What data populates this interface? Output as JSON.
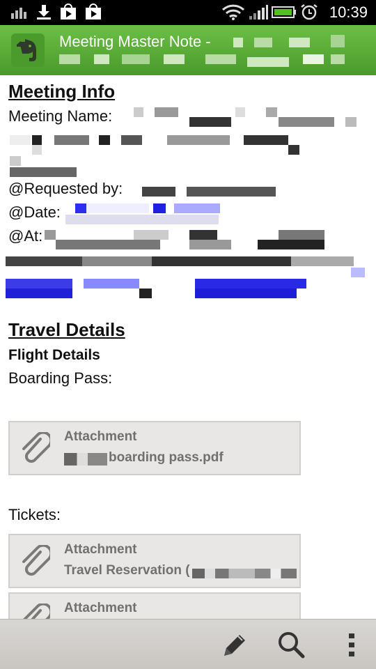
{
  "status_bar": {
    "time": "10:39",
    "icons": [
      "signal-bars-icon",
      "download-icon",
      "play-store-icon",
      "play-store-icon",
      "wifi-icon",
      "cell-signal-icon",
      "battery-icon",
      "alarm-icon"
    ]
  },
  "app_bar": {
    "title": "Meeting Master Note -",
    "icon": "evernote-elephant-icon",
    "color": "#5aa935"
  },
  "note": {
    "meeting_info": {
      "heading": "Meeting Info",
      "meeting_name_label": "Meeting Name:",
      "requested_by_label": "@Requested by:",
      "date_label": "@Date:",
      "at_label": "@At:"
    },
    "travel_details": {
      "heading": "Travel Details",
      "flight_details": "Flight Details",
      "boarding_pass_label": "Boarding Pass:",
      "tickets_label": "Tickets:"
    },
    "attachments": [
      {
        "label": "Attachment",
        "name": "boarding pass.pdf"
      },
      {
        "label": "Attachment",
        "name": "Travel Reservation ("
      },
      {
        "label": "Attachment",
        "name": ""
      }
    ]
  },
  "bottom_bar": {
    "actions": [
      "edit-pencil-icon",
      "search-icon",
      "overflow-menu-icon"
    ]
  }
}
